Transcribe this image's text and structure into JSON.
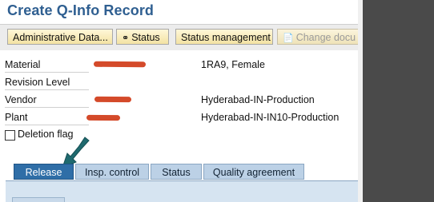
{
  "window": {
    "title": "Create Q-Info Record"
  },
  "toolbar": {
    "buttons": [
      {
        "label": "Administrative Data...",
        "icon": "",
        "enabled": true
      },
      {
        "label": "Status",
        "icon": "glasses-icon",
        "enabled": true
      },
      {
        "label": "Status management",
        "icon": "",
        "enabled": true
      },
      {
        "label": "Change docu",
        "icon": "change-doc-icon",
        "enabled": false
      }
    ]
  },
  "fields": {
    "material": {
      "label": "Material",
      "description": "1RA9, Female"
    },
    "revision": {
      "label": "Revision Level"
    },
    "vendor": {
      "label": "Vendor",
      "description": "Hyderabad-IN-Production"
    },
    "plant": {
      "label": "Plant",
      "description": "Hyderabad-IN-IN10-Production"
    },
    "deletion_flag": {
      "label": "Deletion flag",
      "checked": false
    }
  },
  "tabs": [
    {
      "label": "Release",
      "active": true
    },
    {
      "label": "Insp. control",
      "active": false
    },
    {
      "label": "Status",
      "active": false
    },
    {
      "label": "Quality agreement",
      "active": false
    }
  ],
  "colors": {
    "title": "#2f5f91",
    "active_tab": "#2f6ea7",
    "inactive_tab": "#bcd1e6",
    "redaction": "#d44a2a",
    "arrow": "#1f6a6f"
  }
}
